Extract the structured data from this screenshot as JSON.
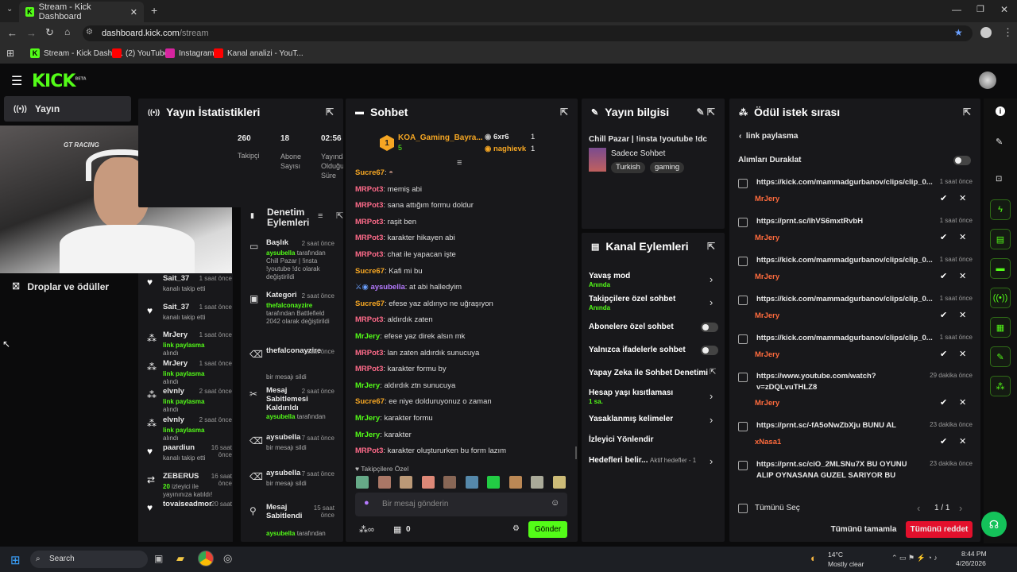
{
  "browser": {
    "tab_title": "Stream - Kick Dashboard",
    "url_host": "dashboard.kick.com",
    "url_path": "/stream",
    "bookmarks": [
      "Stream - Kick Dashb...",
      "(2) YouTube",
      "Instagram",
      "Kanal analizi - YouT..."
    ]
  },
  "app": {
    "logo": "KICK",
    "beta": "BETA"
  },
  "sidebar": {
    "items": [
      {
        "label": "Yayın",
        "icon": "broadcast-icon"
      },
      {
        "label": "Droplar ve ödüller",
        "icon": "gift-icon"
      }
    ]
  },
  "stats": {
    "title": "Yayın İstatistikleri",
    "items": [
      {
        "value": "260",
        "label": "Takipçi"
      },
      {
        "value": "18",
        "label": "Abone Sayısı"
      },
      {
        "value": "02:56",
        "label": "Yayında Olduğu Süre"
      }
    ]
  },
  "activity": [
    {
      "name": "Sait_37",
      "time": "1 saat önce",
      "text": "kanalı takip etti",
      "icon": "heart-icon"
    },
    {
      "name": "Sait_37",
      "time": "1 saat önce",
      "text": "kanalı takip etti",
      "icon": "heart-icon"
    },
    {
      "name": "MrJery",
      "time": "1 saat önce",
      "hl": "link paylasma",
      "text": "alındı",
      "icon": "reward-icon"
    },
    {
      "name": "MrJery",
      "time": "1 saat önce",
      "hl": "link paylasma",
      "text": "alındı",
      "icon": "reward-icon"
    },
    {
      "name": "elvnly",
      "time": "2 saat önce",
      "hl": "link paylasma",
      "text": "alındı",
      "icon": "reward-icon"
    },
    {
      "name": "elvnly",
      "time": "2 saat önce",
      "hl": "link paylasma",
      "text": "alındı",
      "icon": "reward-icon"
    },
    {
      "name": "paardiun",
      "time": "16 saat önce",
      "text": "kanalı takip etti",
      "icon": "heart-icon"
    },
    {
      "name": "ZEBERUS",
      "time": "16 saat önce",
      "hl": "20",
      "text": "izleyici ile yayınınıza katıldı!",
      "icon": "raid-icon"
    },
    {
      "name": "tovaiseadmor",
      "time": "20 saat",
      "text": "",
      "icon": "heart-icon"
    }
  ],
  "moderation": {
    "title": "Denetim Eylemleri",
    "items": [
      {
        "name": "Başlık",
        "time": "2 saat önce",
        "by": "aysubella",
        "text": "tarafından Chill Pazar | !insta !youtube !dc olarak değiştirildi"
      },
      {
        "name": "Kategori",
        "time": "2 saat önce",
        "by": "thefalconayzire",
        "text": "tarafından Battlefield 2042 olarak değiştirildi"
      },
      {
        "name": "thefalconayzire",
        "time": "saat önce",
        "text": "bir mesajı sildi"
      },
      {
        "name": "Mesaj Sabitlemesi Kaldırıldı",
        "time": "2 saat önce",
        "by": "aysubella",
        "text": "tarafından"
      },
      {
        "name": "aysubella",
        "time": "7 saat önce",
        "text": "bir mesajı sildi"
      },
      {
        "name": "aysubella",
        "time": "7 saat önce",
        "text": "bir mesajı sildi"
      },
      {
        "name": "Mesaj Sabitlendi",
        "time": "15 saat önce",
        "by": "aysubella",
        "text": "tarafından"
      }
    ]
  },
  "chat": {
    "title": "Sohbet",
    "top_gifter": {
      "name": "KOA_Gaming_Bayra...",
      "count": "5",
      "rank": "1"
    },
    "leaders": [
      {
        "name": "6xr6",
        "count": "1"
      },
      {
        "name": "naghievk",
        "count": "1"
      }
    ],
    "messages": [
      {
        "user": "Sucre67",
        "color": "orange",
        "text": ""
      },
      {
        "user": "MRPot3",
        "color": "red",
        "text": "memiş abi"
      },
      {
        "user": "MRPot3",
        "color": "red",
        "text": "sana attığım formu doldur"
      },
      {
        "user": "MRPot3",
        "color": "red",
        "text": "raşit ben"
      },
      {
        "user": "MRPot3",
        "color": "red",
        "text": "karakter hikayen abi"
      },
      {
        "user": "MRPot3",
        "color": "red",
        "text": "chat ile yapacan işte"
      },
      {
        "user": "Sucre67",
        "color": "orange",
        "text": "Kafi mi bu"
      },
      {
        "user": "aysubella",
        "color": "purple",
        "text": "at abi halledyim"
      },
      {
        "user": "Sucre67",
        "color": "orange",
        "text": "efese yaz aldınyo ne uğraşıyon"
      },
      {
        "user": "MRPot3",
        "color": "red",
        "text": "aldırdık zaten"
      },
      {
        "user": "MrJery",
        "color": "green",
        "text": "efese yaz direk alsın mk"
      },
      {
        "user": "MRPot3",
        "color": "red",
        "text": "lan zaten aldırdık sunucuya"
      },
      {
        "user": "MRPot3",
        "color": "red",
        "text": "karakter formu by"
      },
      {
        "user": "MrJery",
        "color": "green",
        "text": "aldırdık ztn sunucuya"
      },
      {
        "user": "Sucre67",
        "color": "orange",
        "text": "ee niye dolduruyonuz o zaman"
      },
      {
        "user": "MrJery",
        "color": "green",
        "text": "karakter formu"
      },
      {
        "user": "MrJery",
        "color": "green",
        "text": "karakter"
      },
      {
        "user": "MRPot3",
        "color": "red",
        "text": "karakter oluştururken bu form lazım"
      }
    ],
    "followers_only": "Takipçilere Özel",
    "placeholder": "Bir mesaj gönderin",
    "points": "0",
    "send": "Gönder"
  },
  "stream_info": {
    "title": "Yayın bilgisi",
    "stream_title": "Chill Pazar | !insta !youtube !dc",
    "category": "Sadece Sohbet",
    "tags": [
      "Turkish",
      "gaming"
    ]
  },
  "channel_actions": {
    "title": "Kanal Eylemleri",
    "items": [
      {
        "label": "Yavaş mod",
        "sub": "Anında",
        "control": "chevron"
      },
      {
        "label": "Takipçilere özel sohbet",
        "sub": "Anında",
        "control": "chevron"
      },
      {
        "label": "Abonelere özel sohbet",
        "sub": "",
        "control": "toggle"
      },
      {
        "label": "Yalnızca ifadelerle sohbet",
        "sub": "",
        "control": "toggle"
      },
      {
        "label": "Yapay Zeka ile Sohbet Denetimi",
        "sub": "",
        "control": "external"
      },
      {
        "label": "Hesap yaşı kısıtlaması",
        "sub": "1 sa.",
        "control": "chevron"
      },
      {
        "label": "Yasaklanmış kelimeler",
        "sub": "",
        "control": "chevron"
      },
      {
        "label": "İzleyici Yönlendir",
        "sub": "",
        "control": ""
      },
      {
        "label": "Hedefleri belir...",
        "sub": "",
        "control": "chevron",
        "extra": "Aktif hedefler - 1"
      }
    ]
  },
  "rewards": {
    "title": "Ödül istek sırası",
    "back_label": "link paylasma",
    "pause_label": "Alımları Duraklat",
    "requests": [
      {
        "text": "https://kick.com/mammadgurbanov/clips/clip_0...",
        "user": "MrJery",
        "time": "1 saat önce"
      },
      {
        "text": "https://prnt.sc/lhVS6mxtRvbH",
        "user": "MrJery",
        "time": "1 saat önce"
      },
      {
        "text": "https://kick.com/mammadgurbanov/clips/clip_0...",
        "user": "MrJery",
        "time": "1 saat önce"
      },
      {
        "text": "https://kick.com/mammadgurbanov/clips/clip_0...",
        "user": "MrJery",
        "time": "1 saat önce"
      },
      {
        "text": "https://kick.com/mammadgurbanov/clips/clip_0...",
        "user": "MrJery",
        "time": "1 saat önce"
      },
      {
        "text": "https://www.youtube.com/watch?",
        "text2": "v=zDQLvuTHLZ8",
        "user": "MrJery",
        "time": "29 dakika önce"
      },
      {
        "text": "https://prnt.sc/-fA5oNwZbXju BUNU AL",
        "user": "xNasa1",
        "time": "23 dakika önce"
      },
      {
        "text": "https://prnt.sc/ciO_2MLSNu7X BU OYUNU",
        "text2": "ALIP OYNASANA GUZEL SARIYOR BU",
        "user": "",
        "time": "23 dakika önce"
      }
    ],
    "select_all": "Tümünü Seç",
    "page": "1 / 1",
    "complete_all": "Tümünü tamamla",
    "reject_all": "Tümünü reddet"
  },
  "taskbar": {
    "search": "Search",
    "weather_temp": "14°C",
    "weather_desc": "Mostly clear",
    "time": "8:44 PM",
    "date": "4/26/2026"
  },
  "colors": {
    "accent": "#53fc18",
    "panel": "#18181b",
    "reject": "#e3102c"
  }
}
